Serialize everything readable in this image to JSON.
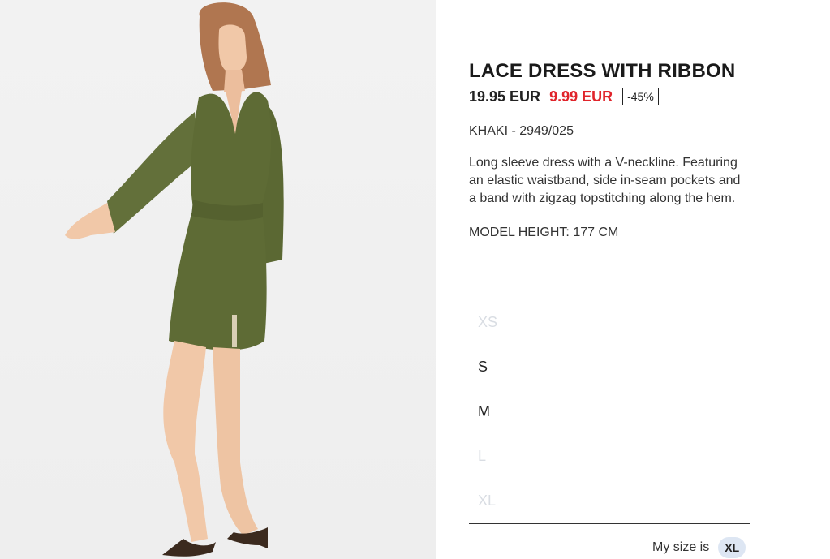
{
  "product": {
    "title": "LACE DRESS WITH RIBBON",
    "old_price": "19.95 EUR",
    "new_price": "9.99 EUR",
    "discount": "-45%",
    "color_ref": "KHAKI - 2949/025",
    "description": "Long sleeve dress with a V-neckline. Featuring an elastic waistband, side in-seam pockets and a band with zigzag topstitching along the hem.",
    "model_height": "MODEL HEIGHT: 177 CM"
  },
  "sizes": [
    {
      "label": "XS",
      "available": false
    },
    {
      "label": "S",
      "available": true
    },
    {
      "label": "M",
      "available": true
    },
    {
      "label": "L",
      "available": false
    },
    {
      "label": "XL",
      "available": false
    }
  ],
  "my_size": {
    "label": "My size is",
    "value": "XL"
  },
  "colors": {
    "sale_red": "#e0242b",
    "dress_khaki": "#5e6b35",
    "badge_bg": "#dde6f3",
    "unavailable": "#d9dde3"
  }
}
